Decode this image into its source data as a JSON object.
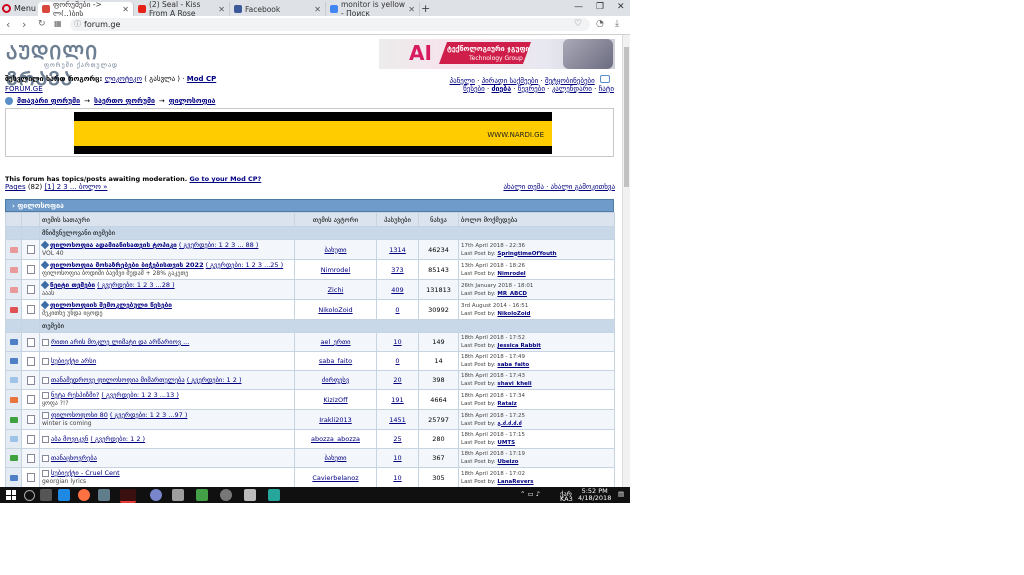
{
  "browser": {
    "menu_label": "Menu",
    "tabs": [
      {
        "title": "ფორუმები -> ლ(..)ბის",
        "active": true,
        "color": "#d9473c"
      },
      {
        "title": "(2) Seal - Kiss From A Rose",
        "active": false,
        "color": "#e62117"
      },
      {
        "title": "Facebook",
        "active": false,
        "color": "#3b5998"
      },
      {
        "title": "monitor is yellow - Поиск",
        "active": false,
        "color": "#4285f4"
      }
    ],
    "new_tab": "+",
    "url": "forum.ge",
    "minimize": "—",
    "maximize": "❐",
    "close": "✕"
  },
  "site": {
    "logo_main": "ᲐᲣᲓᲘᲚᲘ ᲒᲠᲐᲕᲐ",
    "logo_sub": "ფორუმი ქართულად",
    "ad": {
      "ai": "AI",
      "line1": "ტექნოლოგიური ჯგუფი",
      "line2": "Technology Group"
    },
    "user_prefix": "შესვლილი ხართ როგორც:",
    "user_name": "ლიკოტიკო",
    "logout": "( გასვლა )",
    "modcp": "Mod CP",
    "site_link": "FORUM.GE",
    "nav1": [
      "პანელი",
      "პირადი საქმეები",
      "შეტყობინებები"
    ],
    "nav2": [
      "წესები",
      "ძიება",
      "წევრები",
      "კალენდარი",
      "ჩატი"
    ],
    "breadcrumb": [
      "მთავარი ფორუმი",
      "საერთო ფორუმი",
      "ფილოსოფია"
    ],
    "banner_text": "WWW.NARDI.GE",
    "mod_note": "This forum has topics/posts awaiting moderation.",
    "mod_link": "Go to your Mod CP?",
    "pages_label": "Pages",
    "pages_count": "(82)",
    "pages_list": "[1] 2 3 ... ბოლო »",
    "pages_right": "ახალი თემა · ახალი გამოკითხვა",
    "forum_title": "ფილოსოფია",
    "columns": [
      "თემის სათაური",
      "თემის ავტორი",
      "პასუხები",
      "ნახვა",
      "ბოლო მოქმედება"
    ],
    "pinned_label": "მნიშვნელოვანი თემები",
    "topics_label": "თემები",
    "last_post_by": "Last Post by:",
    "pinned": [
      {
        "title": "ფილოსოფია ადამიანისათვის ტოპიკი",
        "pages": "( გვერდები: 1 2 3 ... 88 )",
        "desc": "VOL 40",
        "author": "ბახუთი",
        "replies": "1314",
        "views": "46234",
        "date": "17th April 2018 - 22:36",
        "last": "SpringtimeOfYouth"
      },
      {
        "title": "ფილოსოფია მოსაზრებები ბიჭებისთვის 2022",
        "pages": "( გვერდები: 1 2 3 ...25 )",
        "desc": "ფილოსოფია ბოდიში ბავშვი მუდამ + 28% გაკეთე",
        "author": "Nimrodel",
        "replies": "373",
        "views": "85143",
        "date": "13th April 2018 - 18:26",
        "last": "Nimrodel"
      },
      {
        "title": "ნეიტი თემები",
        "pages": "( გვერდები: 1 2 3 ...28 )",
        "desc": "ააას",
        "author": "Zichi",
        "replies": "409",
        "views": "131813",
        "date": "26th January 2018 - 18:01",
        "last": "MR_ABCD"
      },
      {
        "title": "ფილოსოფიის შემოკლებული წესები",
        "pages": "",
        "desc": "შეკითხე უნდა იცოდე",
        "author": "NikoloZoid",
        "replies": "0",
        "views": "30992",
        "date": "3rd August 2014 - 16:51",
        "last": "NikoloZoid"
      }
    ],
    "topics": [
      {
        "title": "რითი არის მოკლე ლიმატი და არწარიოვ ...",
        "pages": "",
        "desc": "",
        "author": "ael_ერთი",
        "replies": "10",
        "views": "149",
        "date": "18th April 2018 - 17:52",
        "last": "Jessica Rabbit",
        "state": "blue"
      },
      {
        "title": "სუბიექტი არსი",
        "pages": "",
        "desc": "",
        "author": "saba_faito",
        "replies": "0",
        "views": "14",
        "date": "18th April 2018 - 17:49",
        "last": "saba_faito",
        "state": "blue"
      },
      {
        "title": "თანამედროვე ფილოსოფია მიმართულება",
        "pages": "( გვერდები: 1 2 )",
        "desc": "",
        "author": "ძირფესვ",
        "replies": "20",
        "views": "398",
        "date": "18th April 2018 - 17:43",
        "last": "shavi_kheli",
        "state": "light"
      },
      {
        "title": "ნეტა რესპიზმი?",
        "pages": "( გვერდები: 1 2 3 ...13 )",
        "desc": "ყოფა ?!?",
        "author": "KizizOff",
        "replies": "191",
        "views": "4664",
        "date": "18th April 2018 - 17:34",
        "last": "Rataiz",
        "state": "orange"
      },
      {
        "title": "ფილოსოფოსი 80",
        "pages": "( გვერდები: 1 2 3 ...97 )",
        "desc": "winter is coming",
        "author": "Irakli2013",
        "replies": "1451",
        "views": "25797",
        "date": "18th April 2018 - 17:25",
        "last": "გ.ძ.ძ.ძ.ძ",
        "state": "green"
      },
      {
        "title": "აბა მოვიკვნ",
        "pages": "( გვერდები: 1 2 )",
        "desc": "",
        "author": "abozza_abozza",
        "replies": "25",
        "views": "280",
        "date": "18th April 2018 - 17:15",
        "last": "UMTS",
        "state": "light"
      },
      {
        "title": "თანაცხოვრება",
        "pages": "",
        "desc": "",
        "author": "ბახუთი",
        "replies": "10",
        "views": "367",
        "date": "18th April 2018 - 17:19",
        "last": "Ubeizo",
        "state": "green"
      },
      {
        "title": "სუბიექტი - Cruel Cent",
        "pages": "",
        "desc": "georgian lyrics",
        "author": "Cavierbelanoz",
        "replies": "10",
        "views": "305",
        "date": "18th April 2018 - 17:02",
        "last": "LanaRevers",
        "state": "blue"
      }
    ]
  },
  "taskbar": {
    "tray_text": "ქარ",
    "time": "5:52 PM",
    "date": "4/18/2018",
    "lang": "KA3"
  },
  "colors": {
    "forum_header": "#6e9bc9",
    "link": "#000080",
    "ad_yellow": "#ffcc00"
  }
}
